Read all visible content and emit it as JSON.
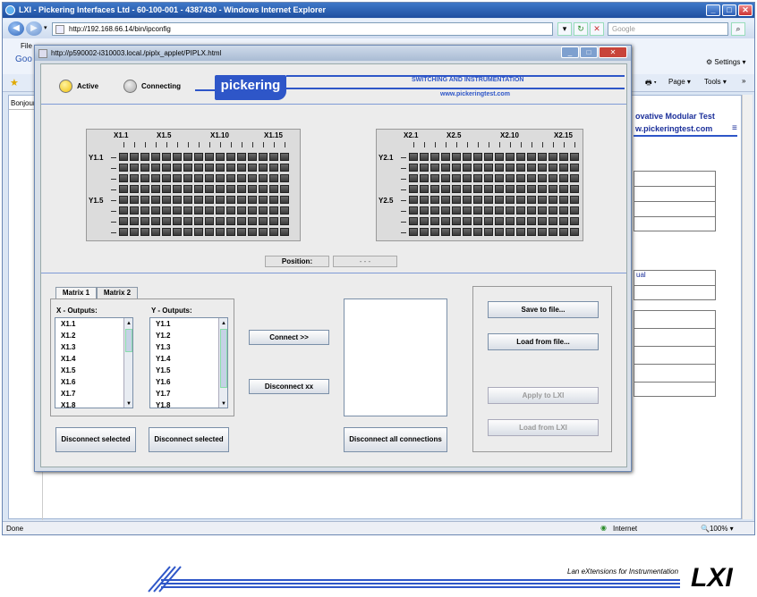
{
  "browser": {
    "title": "LXI - Pickering Interfaces Ltd - 60-100-001 - 4387430 - Windows Internet Explorer",
    "url": "http://192.168.66.14/bin/ipconfig",
    "search_placeholder": "Google",
    "menu_file": "File",
    "bookmark_fragment": "Goo",
    "settings_label": "Settings",
    "page_label": "Page",
    "tools_label": "Tools",
    "side_text": "Bonjour",
    "status_done": "Done",
    "status_zone": "Internet",
    "zoom": "100%"
  },
  "background_page": {
    "heading": "ovative Modular Test",
    "link": "w.pickeringtest.com",
    "fragment_ual": "ual",
    "lxi_tagline": "Lan eXtensions for Instrumentation",
    "lxi_logo": "LXI"
  },
  "popup": {
    "title": "http://p590002-i310003.local./piplx_applet/PIPLX.html"
  },
  "applet": {
    "status_active": "Active",
    "status_connecting": "Connecting",
    "brand": "pickering",
    "tagline": "SWITCHING AND INSTRUMENTATION",
    "website": "www.pickeringtest.com",
    "position_label": "Position:",
    "position_value": "- - -",
    "matrix1": {
      "col_labels": [
        "X1.1",
        "X1.5",
        "X1.10",
        "X1.15"
      ],
      "row_labels": [
        "Y1.1",
        "Y1.5"
      ],
      "cols": 16,
      "rows": 8
    },
    "matrix2": {
      "col_labels": [
        "X2.1",
        "X2.5",
        "X2.10",
        "X2.15"
      ],
      "row_labels": [
        "Y2.1",
        "Y2.5"
      ],
      "cols": 16,
      "rows": 8
    },
    "tabs": [
      "Matrix 1",
      "Matrix 2"
    ],
    "x_outputs_label": "X - Outputs:",
    "y_outputs_label": "Y - Outputs:",
    "x_outputs": [
      "X1.1",
      "X1.2",
      "X1.3",
      "X1.4",
      "X1.5",
      "X1.6",
      "X1.7",
      "X1.8"
    ],
    "y_outputs": [
      "Y1.1",
      "Y1.2",
      "Y1.3",
      "Y1.4",
      "Y1.5",
      "Y1.6",
      "Y1.7",
      "Y1.8"
    ],
    "connect_label": "Connect  >>",
    "disconnect_label": "Disconnect  xx",
    "disconnect_selected_x": "Disconnect selected",
    "disconnect_selected_y": "Disconnect selected",
    "disconnect_all": "Disconnect all connections",
    "save_to_file": "Save to file...",
    "load_from_file": "Load from file...",
    "apply_to_lxi": "Apply to LXI",
    "load_from_lxi": "Load from LXI"
  },
  "colors": {
    "accent_blue": "#2e56c8",
    "active_led": "#f2c20a",
    "connecting_led": "#b8b8b8",
    "cell_dark": "#4a4a4a"
  }
}
